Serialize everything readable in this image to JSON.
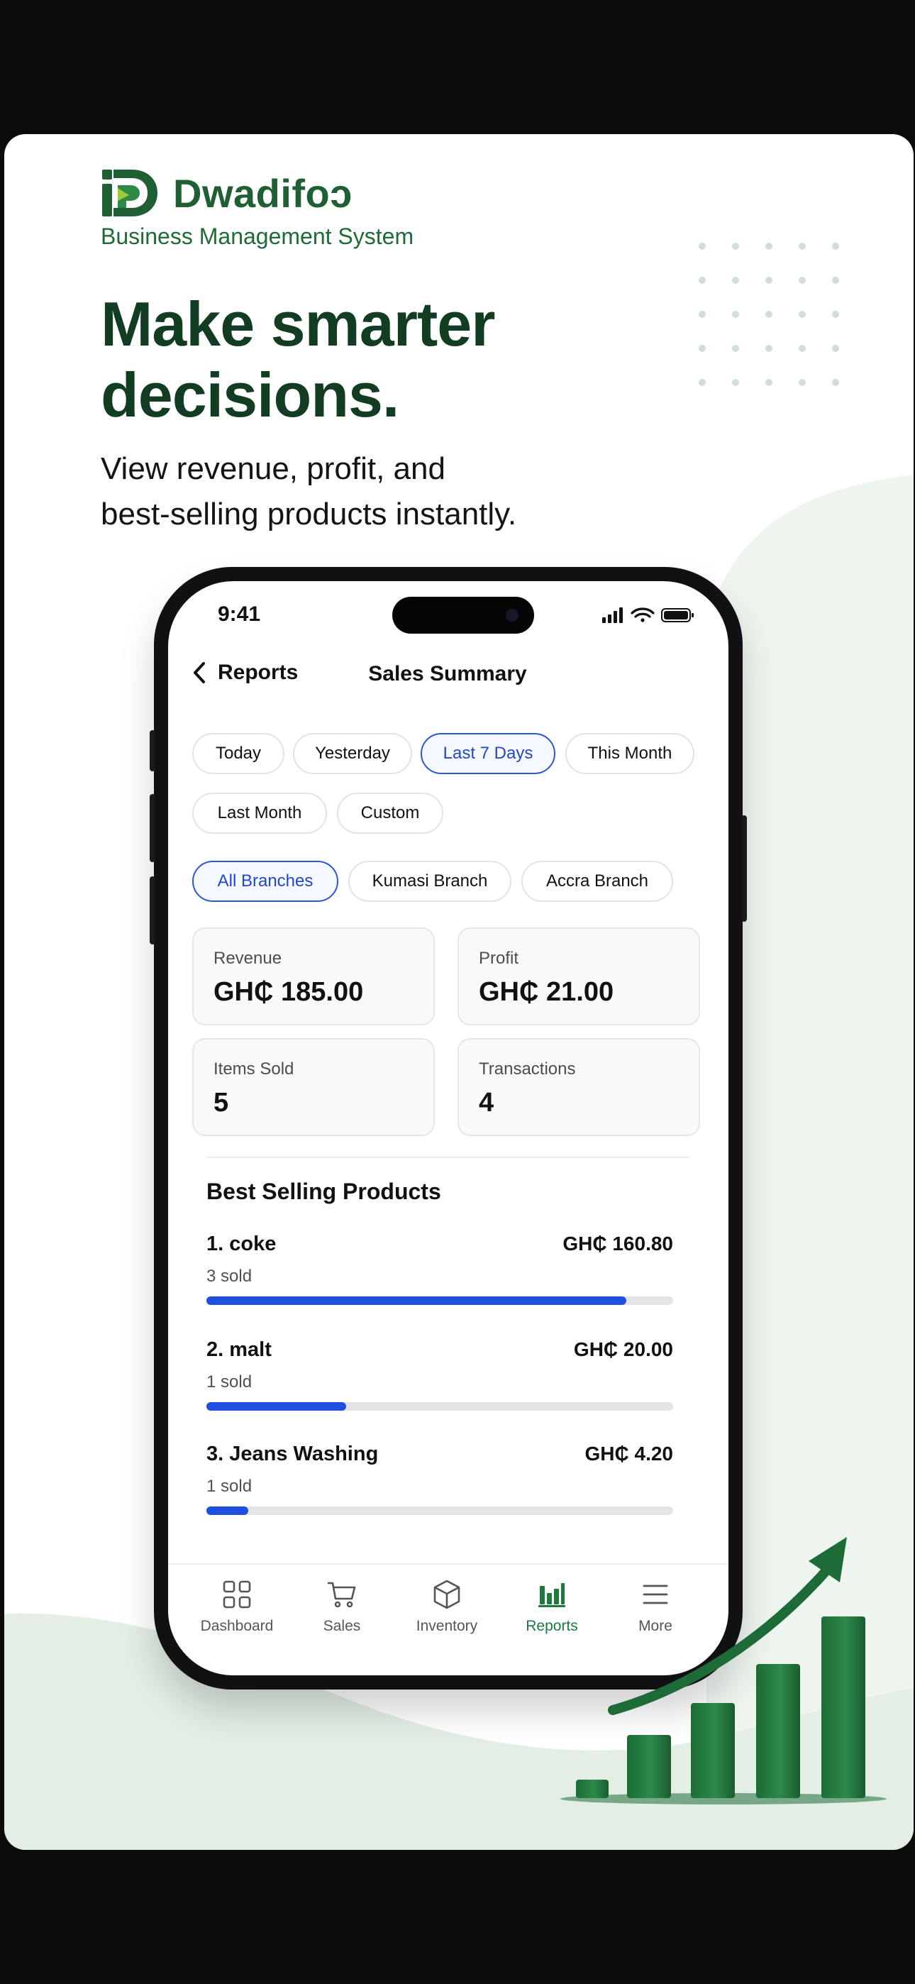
{
  "brand": {
    "name": "Dwadifoɔ",
    "tagline": "Business Management System"
  },
  "hero": {
    "headline_line1": "Make smarter",
    "headline_line2": "decisions.",
    "subhead_line1": "View revenue, profit, and",
    "subhead_line2": "best-selling products instantly."
  },
  "phone": {
    "status": {
      "time": "9:41"
    },
    "nav": {
      "back_label": "Reports",
      "title": "Sales Summary"
    },
    "date_filters": [
      {
        "label": "Today",
        "active": false
      },
      {
        "label": "Yesterday",
        "active": false
      },
      {
        "label": "Last 7 Days",
        "active": true
      },
      {
        "label": "This Month",
        "active": false
      },
      {
        "label": "Last Month",
        "active": false
      },
      {
        "label": "Custom",
        "active": false
      }
    ],
    "branch_filters": [
      {
        "label": "All Branches",
        "active": true
      },
      {
        "label": "Kumasi Branch",
        "active": false
      },
      {
        "label": "Accra Branch",
        "active": false
      }
    ],
    "stats": [
      {
        "label": "Revenue",
        "value": "GH₵ 185.00"
      },
      {
        "label": "Profit",
        "value": "GH₵ 21.00"
      },
      {
        "label": "Items Sold",
        "value": "5"
      },
      {
        "label": "Transactions",
        "value": "4"
      }
    ],
    "best_selling": {
      "title": "Best Selling Products",
      "products": [
        {
          "name": "1. coke",
          "amount": "GH₵ 160.80",
          "sold": "3 sold",
          "share": 0.9
        },
        {
          "name": "2. malt",
          "amount": "GH₵ 20.00",
          "sold": "1 sold",
          "share": 0.3
        },
        {
          "name": "3. Jeans Washing",
          "amount": "GH₵ 4.20",
          "sold": "1 sold",
          "share": 0.09
        }
      ]
    },
    "tabs": [
      {
        "label": "Dashboard",
        "icon": "grid-icon",
        "active": false
      },
      {
        "label": "Sales",
        "icon": "cart-icon",
        "active": false
      },
      {
        "label": "Inventory",
        "icon": "box-icon",
        "active": false
      },
      {
        "label": "Reports",
        "icon": "bar-chart-icon",
        "active": true
      },
      {
        "label": "More",
        "icon": "menu-icon",
        "active": false
      }
    ]
  },
  "colors": {
    "brand_green": "#1f5f33",
    "accent_blue": "#2148c8",
    "active_tab_green": "#1c7a3c"
  }
}
